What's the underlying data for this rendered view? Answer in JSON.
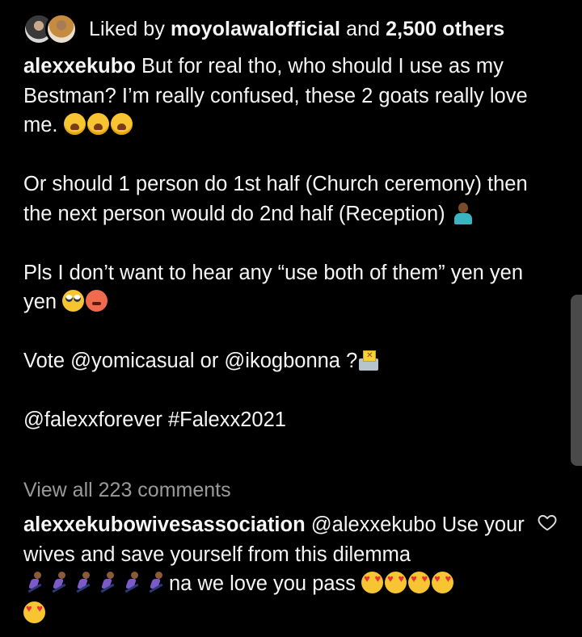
{
  "likes": {
    "prefix": "Liked by",
    "user": "moyolawalofficial",
    "joiner": "and",
    "others": "2,500 others"
  },
  "caption": {
    "username": "alexxekubo",
    "line1_text": "But for real tho, who should I use as my Bestman? I’m really confused, these 2 goats really love me.",
    "line1_emojis": [
      "weary-face-icon",
      "weary-face-icon",
      "weary-face-icon"
    ],
    "para2": "Or should 1 person do 1st half (Church ceremony) then the next person would do 2nd half (Reception)",
    "para2_emoji": "person-shrugging-icon",
    "para3": "Pls I don’t want to hear any “use both of them” yen yen yen",
    "para3_emojis": [
      "face-with-rolling-eyes-icon",
      "angry-face-icon"
    ],
    "para4": "Vote @yomicasual or @ikogbonna ?",
    "para4_emoji": "ballot-box-icon",
    "para5": "@falexxforever #Falexx2021"
  },
  "view_all_comments": "View all 223 comments",
  "comment": {
    "username": "alexxekubowivesassociation",
    "text": "@alexxekubo Use your wives and save yourself from this dilemma",
    "runner_emoji_count": 6,
    "tail_text": "na we love you pass",
    "heart_eyes_count": 5
  },
  "colors": {
    "background": "#000000",
    "text": "#f5f5f5",
    "muted": "#9a9a9a",
    "scrollbar": "#4a4a4a"
  }
}
